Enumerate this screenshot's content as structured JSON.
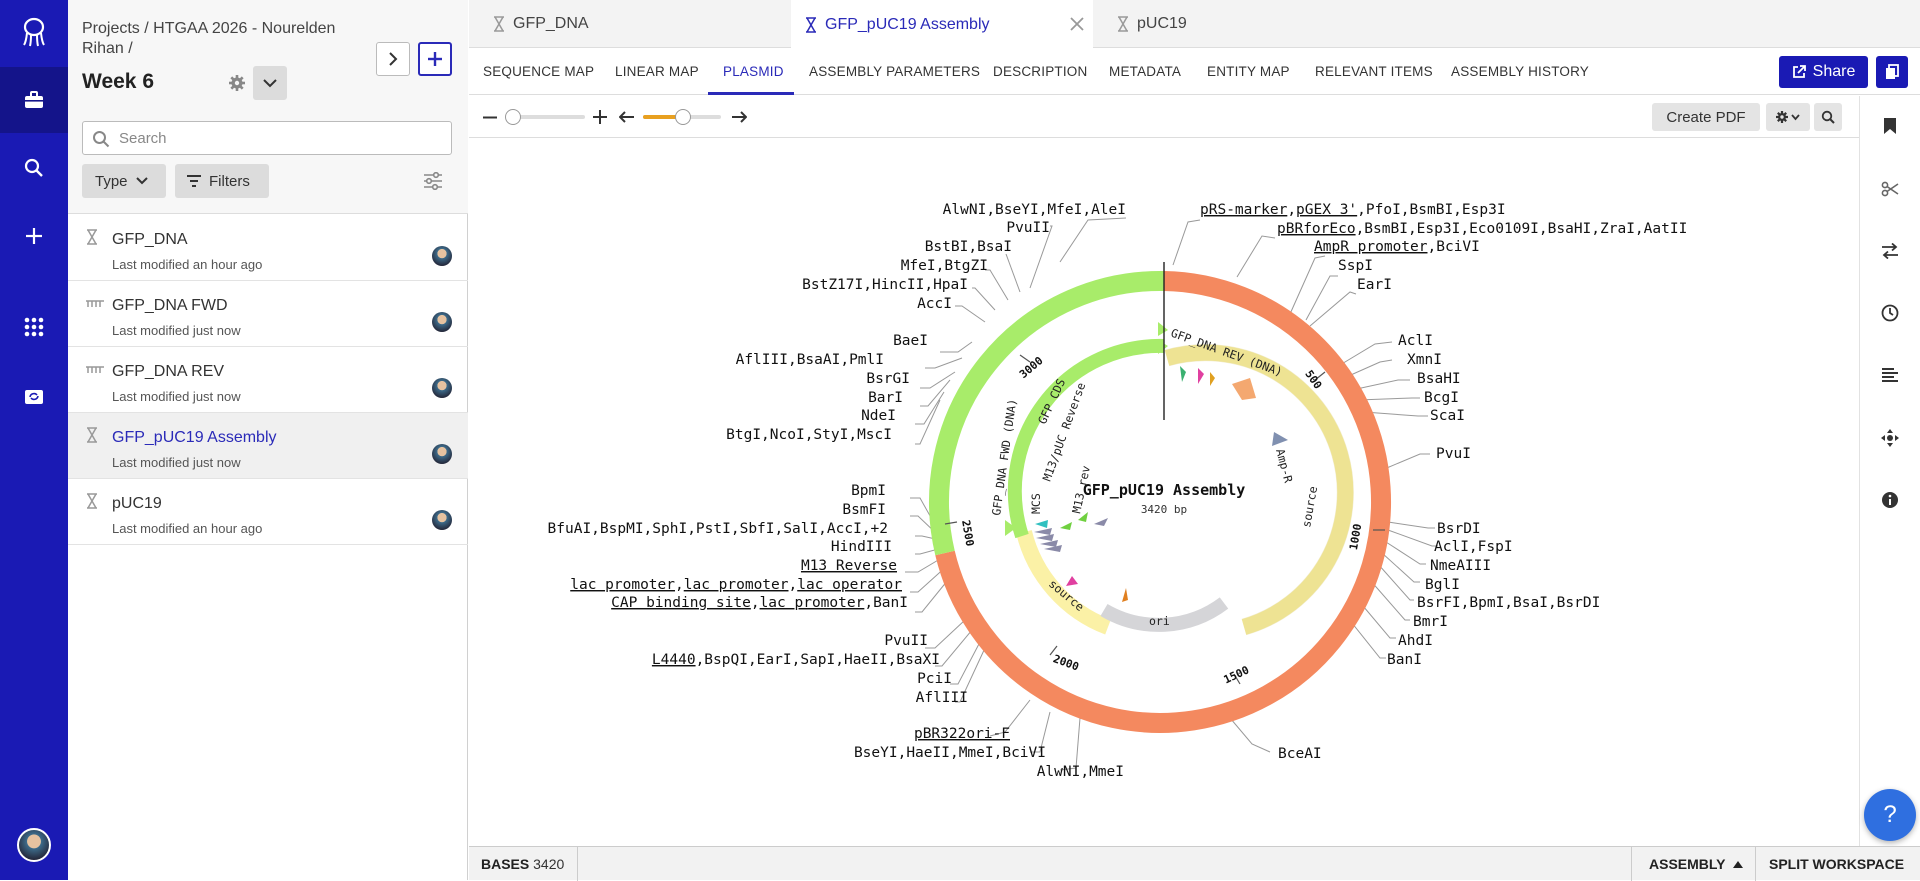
{
  "sidebar": {
    "breadcrumb": "Projects / HTGAA 2026 - Nourelden Rihan /",
    "folder_title": "Week 6",
    "search_placeholder": "Search",
    "type_label": "Type",
    "filters_label": "Filters",
    "items": [
      {
        "name": "GFP_DNA",
        "modified": "Last modified an hour ago",
        "icon": "dna-icon"
      },
      {
        "name": "GFP_DNA FWD",
        "modified": "Last modified just now",
        "icon": "oligo-icon"
      },
      {
        "name": "GFP_DNA REV",
        "modified": "Last modified just now",
        "icon": "oligo-icon"
      },
      {
        "name": "GFP_pUC19 Assembly",
        "modified": "Last modified just now",
        "icon": "dna-icon",
        "selected": true
      },
      {
        "name": "pUC19",
        "modified": "Last modified an hour ago",
        "icon": "dna-icon"
      }
    ]
  },
  "tabs": [
    {
      "label": "GFP_DNA"
    },
    {
      "label": "GFP_pUC19 Assembly",
      "active": true
    },
    {
      "label": "pUC19"
    }
  ],
  "subtabs": [
    "SEQUENCE MAP",
    "LINEAR MAP",
    "PLASMID",
    "ASSEMBLY PARAMETERS",
    "DESCRIPTION",
    "METADATA",
    "ENTITY MAP",
    "RELEVANT ITEMS",
    "ASSEMBLY HISTORY"
  ],
  "active_subtab": "PLASMID",
  "share_label": "Share",
  "create_pdf_label": "Create PDF",
  "plasmid": {
    "name": "GFP_pUC19 Assembly",
    "length": "3420 bp",
    "ticks": [
      "500",
      "1000",
      "1500",
      "2000",
      "2500",
      "3000"
    ],
    "features": {
      "ori": "ori",
      "amp": "Amp-R",
      "source_right": "source",
      "source_bottom": "source",
      "gfp_cds": "GFP CDS",
      "gfp_fwd": "GFP_DNA FWD (DNA)",
      "gfp_rev": "GFP_DNA REV (DNA)",
      "m13_rev": "M13 rev",
      "m13_puc": "M13/pUC Reverse",
      "mcs": "MCS"
    },
    "right_labels": {
      "r1a": "pRS-marker",
      "r1b": "pGEX 3'",
      "r1c": ",PfoI,BsmBI,Esp3I",
      "r2a": "pBRforEco",
      "r2b": ",BsmBI,Esp3I,Eco0109I,BsaHI,ZraI,AatII",
      "r3a": "AmpR promoter",
      "r3b": ",BciVI",
      "r4": "SspI",
      "r5": "EarI",
      "r6": "AclI",
      "r7": "XmnI",
      "r8": "BsaHI",
      "r9": "BcgI",
      "r10": "ScaI",
      "r11": "PvuI",
      "r12": "BsrDI",
      "r13": "AclI,FspI",
      "r14": "NmeAIII",
      "r15": "BglI",
      "r16": "BsrFI,BpmI,BsaI,BsrDI",
      "r17": "BmrI",
      "r18": "AhdI",
      "r19": "BanI",
      "r20": "BceAI"
    },
    "left_labels": {
      "l1": "AlwNI,BseYI,MfeI,AleI",
      "l2": "PvuII",
      "l3": "BstBI,BsaI",
      "l4": "MfeI,BtgZI",
      "l5": "BstZ17I,HincII,HpaI",
      "l6": "AccI",
      "l7": "BaeI",
      "l8": "AflIII,BsaAI,PmlI",
      "l9": "BsrGI",
      "l10": "BarI",
      "l11": "NdeI",
      "l12": "BtgI,NcoI,StyI,MscI",
      "l13": "BpmI",
      "l14": "BsmFI",
      "l15": "BfuAI,BspMI,SphI,PstI,SbfI,SalI,AccI,+2",
      "l16": "HindIII",
      "l17": "M13 Reverse",
      "l18a": "lac promoter",
      "l18b": "lac promoter",
      "l18c": "lac operator",
      "l19a": "CAP binding site",
      "l19b": "lac promoter",
      "l19c": ",BanI",
      "l20": "PvuII",
      "l21a": "L4440",
      "l21b": ",BspQI,EarI,SapI,HaeII,BsaXI",
      "l22": "PciI",
      "l23": "AflIII",
      "l24": "pBR322ori-F",
      "l25": "BseYI,HaeII,MmeI,BciVI",
      "l26": "AlwNI,MmeI"
    }
  },
  "status": {
    "bases_label": "BASES",
    "bases_value": "3420",
    "assembly_label": "ASSEMBLY",
    "split_label": "SPLIT WORKSPACE"
  },
  "colors": {
    "rail": "#1a1ab4",
    "accent": "#2a2ab8",
    "backbone": "#f4895f",
    "insert": "#a8ec6a",
    "feature_yellow": "#fbf1a6",
    "ori": "#d5d5d8"
  }
}
